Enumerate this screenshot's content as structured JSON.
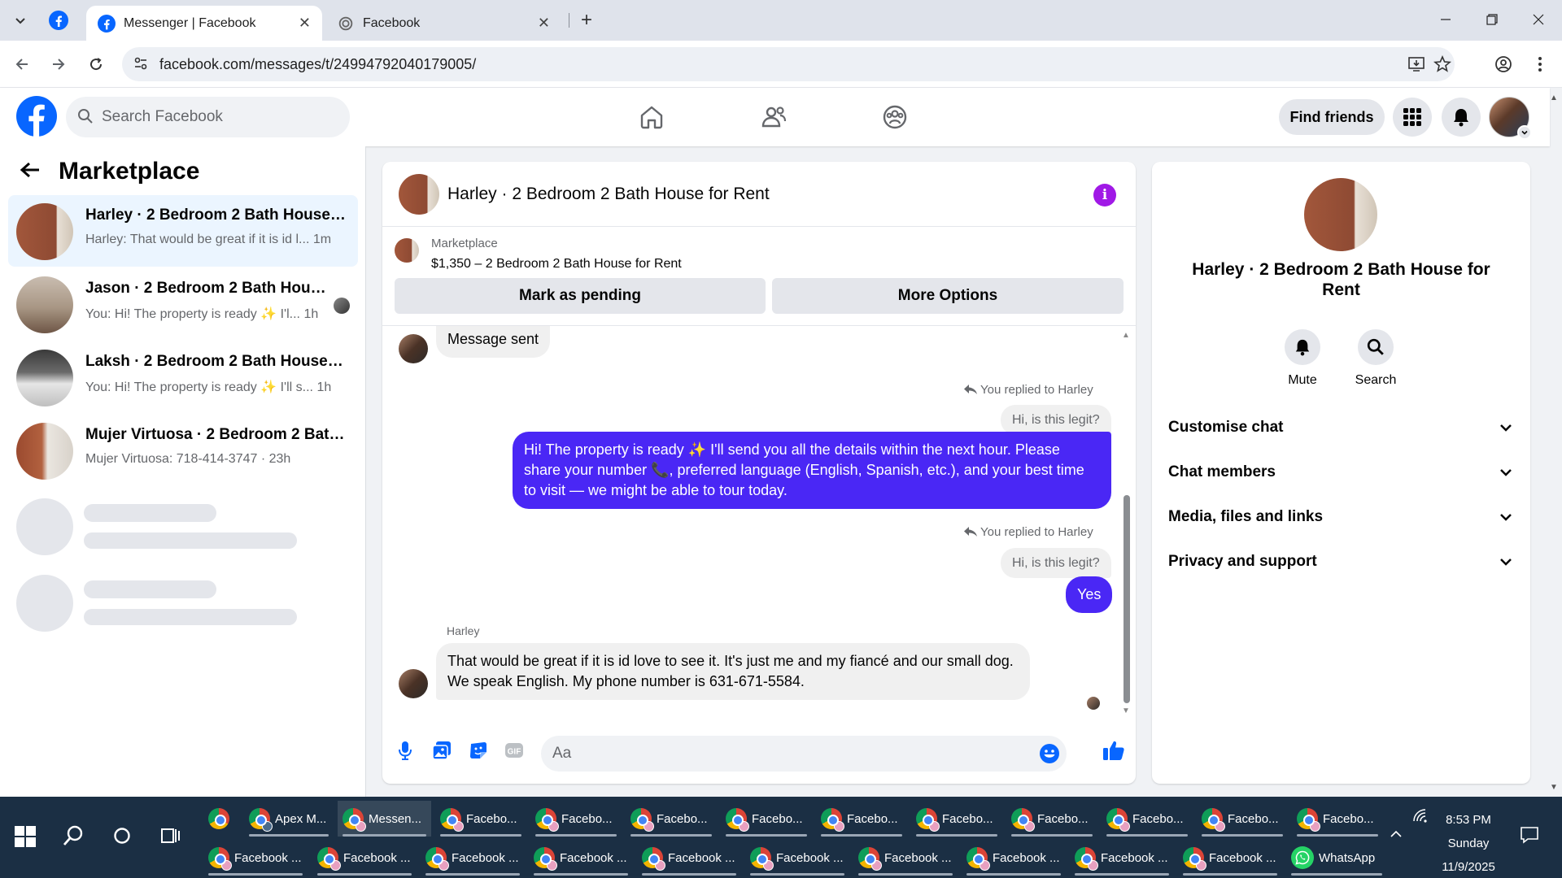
{
  "browser": {
    "tabs": [
      {
        "title": "Messenger | Facebook",
        "active": true
      },
      {
        "title": "Facebook",
        "active": false
      }
    ],
    "url": "facebook.com/messages/t/24994792040179005/",
    "new_tab_label": "+",
    "close_glyph": "✕"
  },
  "fb": {
    "search_placeholder": "Search Facebook",
    "find_friends": "Find friends",
    "brand_color": "#0866ff"
  },
  "sidebar": {
    "title": "Marketplace",
    "conversations": [
      {
        "name": "Harley · 2 Bedroom 2 Bath House f...",
        "preview": "Harley: That would be great if it is id l...",
        "time": "1m",
        "active": true
      },
      {
        "name": "Jason · 2 Bedroom 2 Bath House...",
        "preview": "You: Hi! The property is ready ✨ I'l...",
        "time": "1h",
        "active": false
      },
      {
        "name": "Laksh · 2 Bedroom 2 Bath House f...",
        "preview": "You: Hi! The property is ready ✨ I'll s...",
        "time": "1h",
        "active": false
      },
      {
        "name": "Mujer Virtuosa · 2 Bedroom 2 Bath...",
        "preview": "Mujer Virtuosa: 718-414-3747",
        "time": "23h",
        "active": false
      }
    ]
  },
  "chat": {
    "title": "Harley · 2 Bedroom 2 Bath House for Rent",
    "marketplace_label": "Marketplace",
    "listing": "$1,350 – 2 Bedroom 2 Bath House for Rent",
    "mark_pending": "Mark as pending",
    "more_options": "More Options",
    "messages": {
      "sent_notice": "Message sent",
      "reply_note_1": "You replied to Harley",
      "quote_1": "Hi, is this legit?",
      "outgoing_1": "Hi! The property is ready ✨ I'll send you all the details within the next hour. Please share your number 📞, preferred language (English, Spanish, etc.), and your best time to visit — we might be able to tour today.",
      "reply_note_2": "You replied to Harley",
      "quote_2": "Hi, is this legit?",
      "outgoing_2": "Yes",
      "incoming_sender": "Harley",
      "incoming_1": "That would be great if it is id love to see it. It's just me and my fiancé and our small dog. We speak English. My phone number is 631-671-5584."
    },
    "composer_placeholder": "Aa",
    "accent_color": "#4a27f5"
  },
  "info_panel": {
    "name": "Harley · 2 Bedroom 2 Bath House for Rent",
    "actions": [
      "Mute",
      "Search"
    ],
    "sections": [
      "Customise chat",
      "Chat members",
      "Media, files and links",
      "Privacy and support"
    ]
  },
  "taskbar": {
    "row1": [
      "Apex M...",
      "Messen...",
      "Facebo...",
      "Facebo...",
      "Facebo...",
      "Facebo...",
      "Facebo...",
      "Facebo...",
      "Facebo...",
      "Facebo...",
      "Facebo...",
      "Facebo..."
    ],
    "row2": [
      "Facebook ...",
      "Facebook ...",
      "Facebook ...",
      "Facebook ...",
      "Facebook ...",
      "Facebook ...",
      "Facebook ...",
      "Facebook ...",
      "Facebook ...",
      "Facebook ...",
      "WhatsApp"
    ],
    "time": "8:53 PM",
    "day": "Sunday",
    "date": "11/9/2025"
  }
}
